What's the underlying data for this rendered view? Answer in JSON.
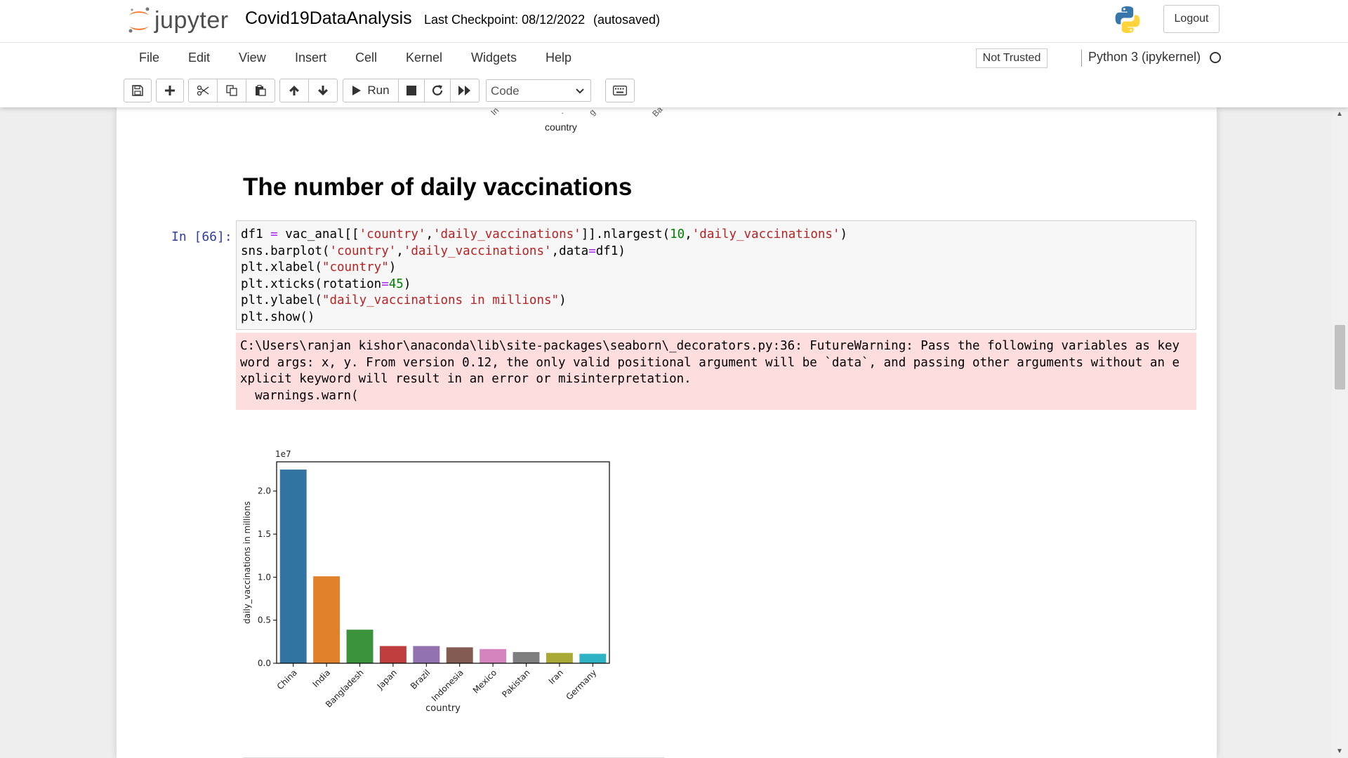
{
  "header": {
    "logo_text": "jupyter",
    "notebook_title": "Covid19DataAnalysis",
    "checkpoint": "Last Checkpoint: 08/12/2022",
    "autosave": "(autosaved)",
    "logout_label": "Logout"
  },
  "menubar": {
    "items": [
      "File",
      "Edit",
      "View",
      "Insert",
      "Cell",
      "Kernel",
      "Widgets",
      "Help"
    ],
    "trust_status": "Not Trusted",
    "kernel_name": "Python 3 (ipykernel)"
  },
  "toolbar": {
    "buttons": [
      "save-icon",
      "plus-icon",
      "cut-icon",
      "copy-icon",
      "paste-icon",
      "arrow-up-icon",
      "arrow-down-icon",
      "run-button",
      "stop-icon",
      "restart-icon",
      "fast-forward-icon",
      "keyboard-icon"
    ],
    "run_label": "Run",
    "cell_type": "Code"
  },
  "notebook": {
    "prev_output_xlabel": "country",
    "section_heading": "The number of daily vaccinations",
    "cell_prompt": "In [66]:",
    "stderr_lines": [
      "C:\\Users\\ranjan kishor\\anaconda\\lib\\site-packages\\seaborn\\_decorators.py:36: FutureWarning: Pass the following variables as key",
      "word args: x, y. From version 0.12, the only valid positional argument will be `data`, and passing other arguments without an e",
      "xplicit keyword will result in an error or misinterpretation.",
      "  warnings.warn("
    ]
  },
  "chart_data": {
    "type": "bar",
    "categories": [
      "China",
      "India",
      "Bangladesh",
      "Japan",
      "Brazil",
      "Indonesia",
      "Mexico",
      "Pakistan",
      "Iran",
      "Germany"
    ],
    "values": [
      22500000,
      10100000,
      3900000,
      2000000,
      2000000,
      1850000,
      1650000,
      1300000,
      1200000,
      1100000
    ],
    "colors": [
      "#3274a1",
      "#e1812c",
      "#3a923a",
      "#c03d3e",
      "#9372b2",
      "#845b53",
      "#d684bd",
      "#7f7f7f",
      "#a9aa35",
      "#2eb3c4"
    ],
    "ylim": [
      0,
      23400000
    ],
    "yticks": [
      "0.0",
      "0.5",
      "1.0",
      "1.5",
      "2.0"
    ],
    "ytick_values": [
      0,
      5000000,
      10000000,
      15000000,
      20000000
    ],
    "offset_label": "1e7",
    "xlabel": "country",
    "ylabel": "daily_vaccinations in millions"
  }
}
